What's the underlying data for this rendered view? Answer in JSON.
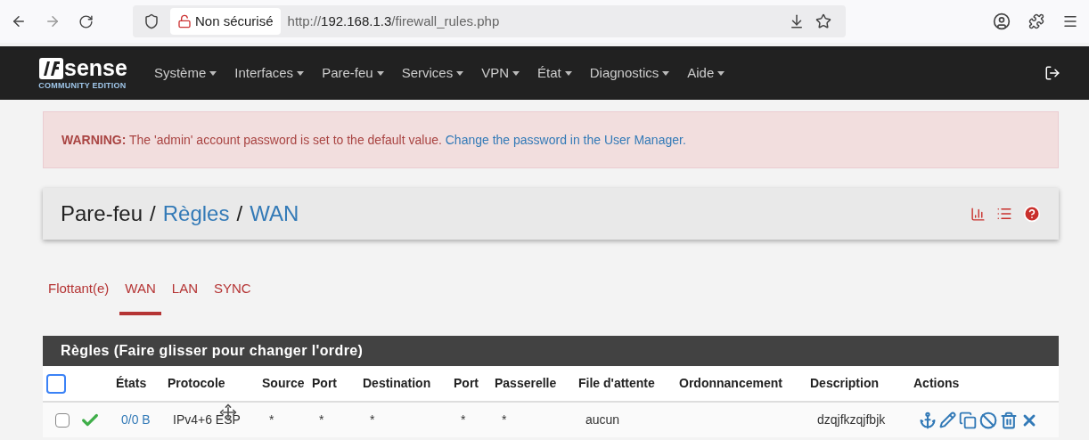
{
  "browser": {
    "security": "Non sécurisé",
    "url_scheme": "http://",
    "url_host": "192.168.1.3",
    "url_path": "/firewall_rules.php"
  },
  "navbar": {
    "logo_top": "sense",
    "logo_sub": "COMMUNITY EDITION",
    "items": [
      "Système",
      "Interfaces",
      "Pare-feu",
      "Services",
      "VPN",
      "État",
      "Diagnostics",
      "Aide"
    ]
  },
  "warning": {
    "label": "WARNING:",
    "text": "The 'admin' account password is set to the default value.",
    "link": "Change the password in the User Manager."
  },
  "breadcrumb": {
    "root": "Pare-feu",
    "separator": "/",
    "parts": [
      "Règles",
      "WAN"
    ]
  },
  "tabs": [
    {
      "label": "Flottant(e)",
      "selected": false
    },
    {
      "label": "WAN",
      "selected": true
    },
    {
      "label": "LAN",
      "selected": false
    },
    {
      "label": "SYNC",
      "selected": false
    }
  ],
  "table": {
    "title": "Règles (Faire glisser pour changer l'ordre)",
    "select_all_checked": false,
    "columns": [
      "États",
      "Protocole",
      "Source",
      "Port",
      "Destination",
      "Port",
      "Passerelle",
      "File d'attente",
      "Ordonnancement",
      "Description",
      "Actions"
    ],
    "rows": [
      {
        "checked": false,
        "enabled": true,
        "states": "0/0 B",
        "protocol": "IPv4+6 ESP",
        "source": "*",
        "source_port": "*",
        "destination": "*",
        "destination_port": "*",
        "gateway": "*",
        "queue": "aucun",
        "description": "dzqjfkzqjfbjk"
      }
    ]
  }
}
